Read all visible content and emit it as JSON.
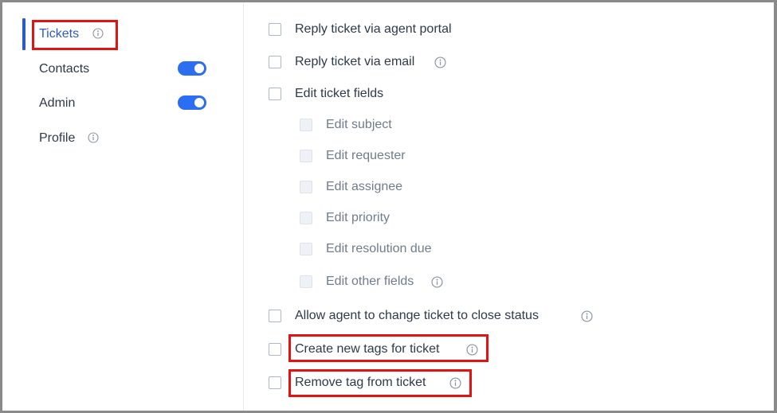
{
  "sidebar": {
    "items": [
      {
        "label": "Tickets",
        "active": true,
        "info": true
      },
      {
        "label": "Contacts",
        "toggle": true
      },
      {
        "label": "Admin",
        "toggle": true
      },
      {
        "label": "Profile",
        "info": true
      }
    ]
  },
  "permissions": [
    {
      "label": "Reply ticket via agent portal"
    },
    {
      "label": "Reply ticket via email",
      "info": true
    },
    {
      "label": "Edit ticket fields"
    },
    {
      "label": "Edit subject",
      "sub": true
    },
    {
      "label": "Edit requester",
      "sub": true
    },
    {
      "label": "Edit assignee",
      "sub": true
    },
    {
      "label": "Edit priority",
      "sub": true
    },
    {
      "label": "Edit resolution due",
      "sub": true
    },
    {
      "label": "Edit other fields",
      "sub": true,
      "info": true
    },
    {
      "label": "Allow agent to change ticket to close status",
      "info": true
    },
    {
      "label": "Create new tags for ticket",
      "info": true
    },
    {
      "label": "Remove tag from ticket",
      "info": true
    }
  ],
  "colors": {
    "accent": "#2c5cc5",
    "toggle_on": "#2c6ef2",
    "highlight": "#e31313"
  }
}
